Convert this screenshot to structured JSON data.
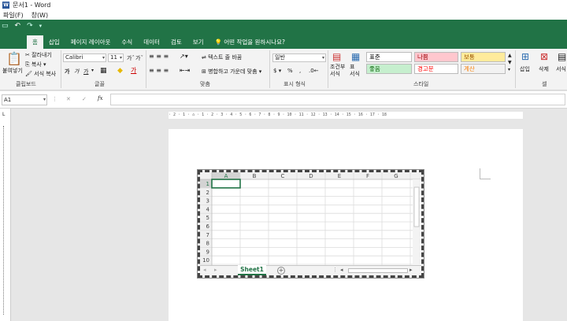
{
  "window": {
    "title": "문서1 - Word"
  },
  "menu": [
    "파일(F)",
    "창(W)"
  ],
  "tabs": [
    "홈",
    "삽입",
    "페이지 레이아웃",
    "수식",
    "데이터",
    "검토",
    "보기"
  ],
  "tell_me": "어떤 작업을 원하시나요?",
  "clipboard": {
    "paste": "붙여넣기",
    "cut": "잘라내기",
    "copy": "복사",
    "format_painter": "서식 복사",
    "group": "클립보드"
  },
  "font": {
    "name": "Calibri",
    "size": "11",
    "bold": "가",
    "italic": "가",
    "underline": "가",
    "grow": "가",
    "shrink": "가",
    "color_letter": "가",
    "group": "글꼴"
  },
  "alignment": {
    "wrap": "텍스트 줄 바꿈",
    "merge": "병합하고 가운데 맞춤",
    "group": "맞춤"
  },
  "number": {
    "format": "일반",
    "currency": "$",
    "percent": "%",
    "comma": ",",
    "group": "표시 형식"
  },
  "styles": {
    "conditional": "조건부 서식",
    "table": "표 서식",
    "cells": [
      {
        "label": "표준",
        "bg": "#ffffff",
        "fg": "#000000"
      },
      {
        "label": "나쁨",
        "bg": "#ffc7ce",
        "fg": "#9c0006"
      },
      {
        "label": "보통",
        "bg": "#ffeb9c",
        "fg": "#9c5700"
      },
      {
        "label": "좋음",
        "bg": "#c6efce",
        "fg": "#006100"
      },
      {
        "label": "경고문",
        "bg": "#ffffff",
        "fg": "#ff0000"
      },
      {
        "label": "계산",
        "bg": "#f2f2f2",
        "fg": "#fa7d00"
      }
    ],
    "group": "스타일"
  },
  "cells_group": {
    "insert": "삽입",
    "delete": "삭제",
    "format": "서식",
    "group": "셀"
  },
  "formula": {
    "name_box": "A1",
    "fx": "fx",
    "cancel": "✕",
    "enter": "✓"
  },
  "ruler": "· 2 · 1 · ⌂ · 1 · 2 · 3 · 4 · 5 · 6 · 7 · 8 · 9 · 10 · 11 · 12 · 13 · 14 · 15 · 16 · 17 · 18",
  "sheet": {
    "columns": [
      "A",
      "B",
      "C",
      "D",
      "E",
      "F",
      "G"
    ],
    "rows": [
      "1",
      "2",
      "3",
      "4",
      "5",
      "6",
      "7",
      "8",
      "9",
      "10"
    ],
    "tab_name": "Sheet1",
    "add": "+"
  },
  "colors": {
    "accent": "#217346",
    "tab_text": "#ffffff"
  }
}
